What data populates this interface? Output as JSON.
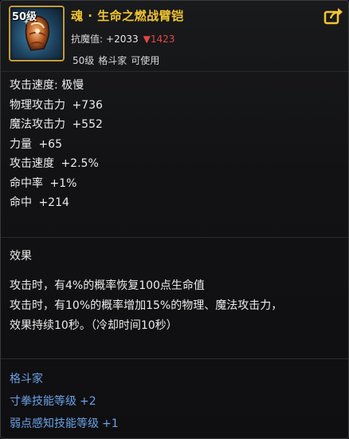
{
  "item": {
    "level_badge": "50级",
    "title": "魂 · 生命之燃战臂铠",
    "resist_label": "抗魔值:",
    "resist_value": "+2033",
    "resist_delta": "▼1423",
    "requirement": {
      "level": "50级",
      "class": "格斗家",
      "usable": "可使用"
    }
  },
  "stats": [
    {
      "label": "攻击速度:",
      "value": "极慢"
    },
    {
      "label": "物理攻击力",
      "value": "+736"
    },
    {
      "label": "魔法攻击力",
      "value": "+552"
    },
    {
      "label": "力量",
      "value": "+65"
    },
    {
      "label": "攻击速度",
      "value": "+2.5%"
    },
    {
      "label": "命中率",
      "value": "+1%"
    },
    {
      "label": "命中",
      "value": "+214"
    }
  ],
  "effects": {
    "title": "效果",
    "lines": [
      "攻击时，有4%的概率恢复100点生命值",
      "攻击时，有10%的概率增加15%的物理、魔法攻击力，",
      "效果持续10秒。（冷却时间10秒）"
    ]
  },
  "skills": {
    "class_title": "格斗家",
    "lines": [
      {
        "label": "寸拳技能等级",
        "value": "+2"
      },
      {
        "label": "弱点感知技能等级",
        "value": "+1"
      }
    ]
  },
  "colors": {
    "title": "#f2c531",
    "down": "#e04747",
    "skill": "#6aa2e6",
    "frame": "#c79a3a"
  },
  "icons": {
    "item": "gauntlet-icon",
    "share": "share-icon",
    "down": "down-triangle-icon"
  }
}
